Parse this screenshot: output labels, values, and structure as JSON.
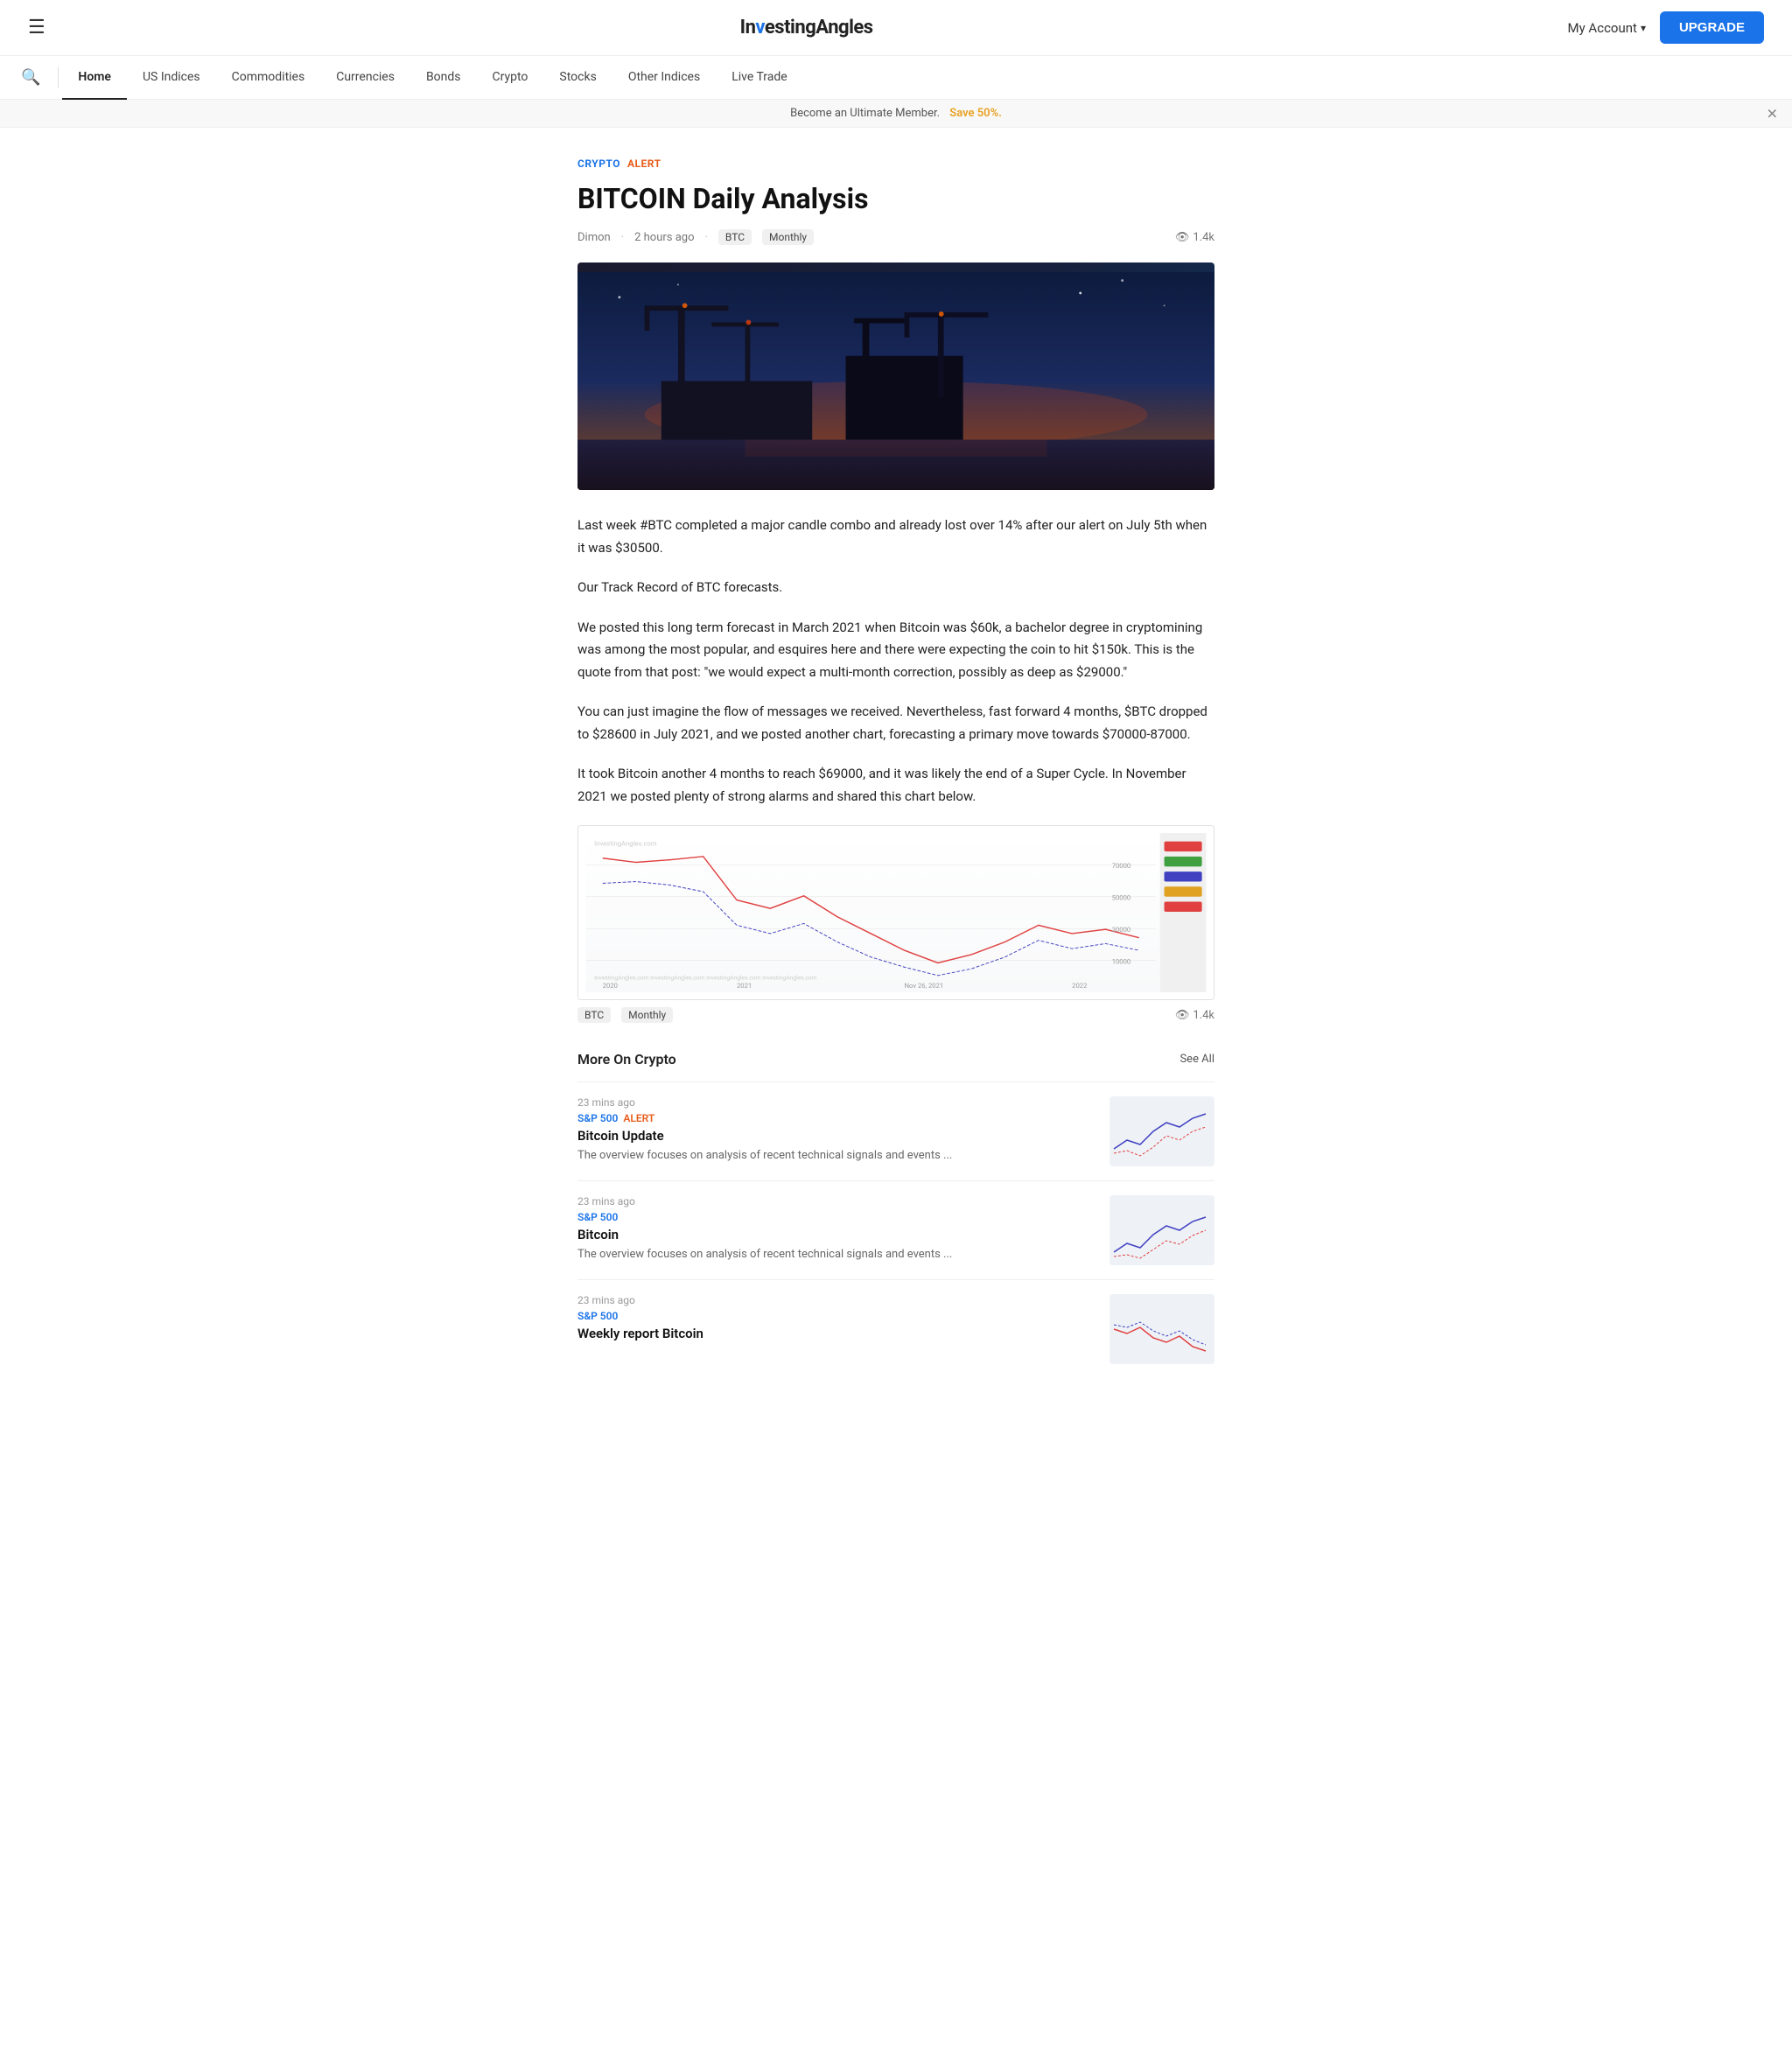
{
  "header": {
    "logo_text_1": "In",
    "logo_text_2": "vesting",
    "logo_text_3": "Angles",
    "my_account_label": "My Account",
    "upgrade_label": "UPGRADE"
  },
  "nav": {
    "items": [
      {
        "label": "Home",
        "active": true
      },
      {
        "label": "US Indices",
        "active": false
      },
      {
        "label": "Commodities",
        "active": false
      },
      {
        "label": "Currencies",
        "active": false
      },
      {
        "label": "Bonds",
        "active": false
      },
      {
        "label": "Crypto",
        "active": false
      },
      {
        "label": "Stocks",
        "active": false
      },
      {
        "label": "Other Indices",
        "active": false
      },
      {
        "label": "Live Trade",
        "active": false
      }
    ]
  },
  "banner": {
    "text": "Become an Ultimate Member.",
    "save_text": "Save 50%."
  },
  "article": {
    "tag_crypto": "CRYPTO",
    "tag_alert": "ALERT",
    "title": "BITCOIN Daily Analysis",
    "author": "Dimon",
    "time_ago": "2 hours ago",
    "category": "BTC",
    "frequency": "Monthly",
    "views": "1.4k",
    "body_p1": "Last week #BTC completed a major candle combo and already lost over 14% after our alert on July 5th when it was $30500.",
    "body_p2": "Our Track Record of BTC forecasts.",
    "body_p3": "We posted this long term forecast in March 2021 when Bitcoin was $60k, a bachelor degree in cryptomining was among the most popular, and esquires here and there were expecting the coin to hit $150k. This is the quote from that post: \"we would expect a multi-month correction, possibly as deep as $29000.\"",
    "body_p4": "You can just imagine the flow of messages we received. Nevertheless, fast forward 4 months, $BTC dropped to $28600 in July 2021, and we posted another chart, forecasting a primary move towards $70000-87000.",
    "body_p5": "It took Bitcoin another 4 months to reach $69000, and it was likely the end of a Super Cycle. In November 2021 we posted plenty of strong alarms and shared this chart below.",
    "chart_category": "BTC",
    "chart_frequency": "Monthly",
    "chart_views": "1.4k"
  },
  "more_section": {
    "title": "More On Crypto",
    "see_all_label": "See All",
    "cards": [
      {
        "time_ago": "23 mins ago",
        "tag_sp500": "S&P 500",
        "tag_alert": "ALERT",
        "title": "Bitcoin Update",
        "description": "The overview focuses on analysis of recent technical signals and events ..."
      },
      {
        "time_ago": "23 mins ago",
        "tag_sp500": "S&P 500",
        "tag_alert": "",
        "title": "Bitcoin",
        "description": "The overview focuses on analysis of recent technical signals and events ..."
      },
      {
        "time_ago": "23 mins ago",
        "tag_sp500": "S&P 500",
        "tag_alert": "",
        "title": "Weekly report Bitcoin",
        "description": ""
      }
    ]
  }
}
